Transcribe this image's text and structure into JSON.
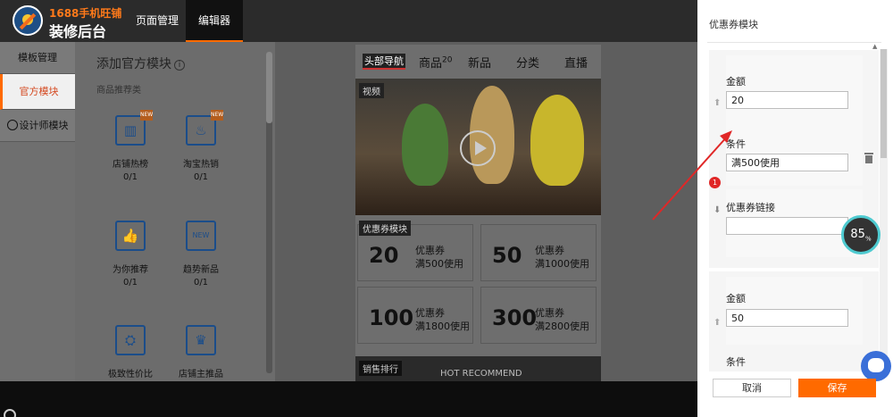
{
  "header": {
    "brand_top": "1688手机旺铺",
    "brand_bottom": "装修后台",
    "tabs": [
      {
        "label": "页面管理",
        "active": false
      },
      {
        "label": "编辑器",
        "active": true
      }
    ]
  },
  "sidebar": {
    "items": [
      {
        "label": "模板管理",
        "active": false
      },
      {
        "label": "官方模块",
        "active": true
      },
      {
        "label": "设计师模块",
        "active": false
      }
    ]
  },
  "modules_panel": {
    "title": "添加官方模块",
    "info_icon": "i",
    "section": "商品推荐类",
    "modules": [
      {
        "name": "店铺热榜",
        "count": "0/1",
        "icon": "bar-chart-icon",
        "glyph": "▥",
        "badge": "NEW"
      },
      {
        "name": "淘宝热销",
        "count": "0/1",
        "icon": "fire-icon",
        "glyph": "♨",
        "badge": "NEW"
      },
      {
        "name": "为你推荐",
        "count": "0/1",
        "icon": "thumbs-up-icon",
        "glyph": "👍",
        "badge": ""
      },
      {
        "name": "趋势新品",
        "count": "0/1",
        "icon": "new-tag-icon",
        "glyph": "NEW",
        "badge": ""
      },
      {
        "name": "极致性价比",
        "count": "",
        "icon": "user-price-icon",
        "glyph": "⛭",
        "badge": ""
      },
      {
        "name": "店铺主推品",
        "count": "",
        "icon": "crown-icon",
        "glyph": "♛",
        "badge": ""
      }
    ]
  },
  "preview": {
    "tabs": [
      {
        "label": "头部导航",
        "active": true,
        "sup": ""
      },
      {
        "label": "商品",
        "active": false,
        "sup": "20"
      },
      {
        "label": "新品",
        "active": false,
        "sup": ""
      },
      {
        "label": "分类",
        "active": false,
        "sup": ""
      },
      {
        "label": "直播",
        "active": false,
        "sup": ""
      }
    ],
    "video_label": "视频",
    "coupon_label": "优惠券模块",
    "coupons": [
      {
        "amount": "20",
        "name": "优惠券",
        "condition": "满500使用"
      },
      {
        "amount": "50",
        "name": "优惠券",
        "condition": "满1000使用"
      },
      {
        "amount": "100",
        "name": "优惠券",
        "condition": "满1800使用"
      },
      {
        "amount": "300",
        "name": "优惠券",
        "condition": "满2800使用"
      }
    ],
    "sales_label": "销售排行",
    "hot_label": "HOT RECOMMEND"
  },
  "right_panel": {
    "title": "优惠券模块",
    "coupon_groups": [
      {
        "amount_label": "金额",
        "amount_value": "20",
        "condition_label": "条件",
        "condition_value": "满500使用",
        "link_label": "优惠券链接",
        "link_value": ""
      },
      {
        "amount_label": "金额",
        "amount_value": "50",
        "condition_label": "条件",
        "condition_value": "",
        "link_label": "",
        "link_value": ""
      }
    ],
    "cancel_label": "取消",
    "save_label": "保存"
  },
  "annotation": {
    "badge": "1"
  },
  "gauge": {
    "value": "85",
    "unit": "%"
  },
  "colors": {
    "accent": "#ff6a00",
    "brand_blue": "#1b4d8a",
    "annotation_red": "#e02727"
  }
}
